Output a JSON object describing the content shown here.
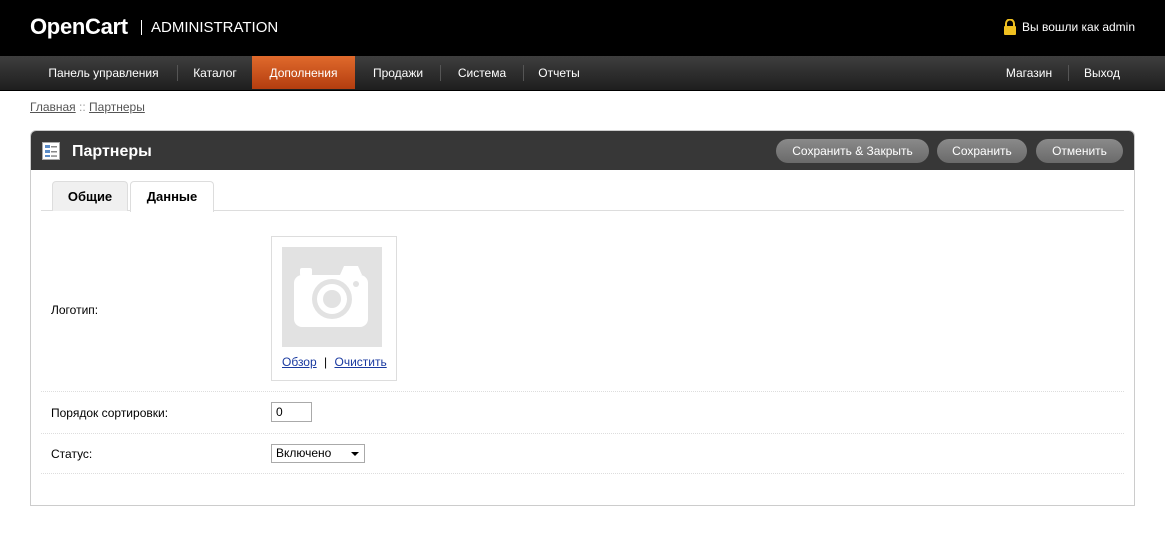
{
  "header": {
    "logo": "OpenCart",
    "admin_label": "ADMINISTRATION",
    "login_text": "Вы вошли как admin"
  },
  "menu": {
    "left": [
      "Панель управления",
      "Каталог",
      "Дополнения",
      "Продажи",
      "Система",
      "Отчеты"
    ],
    "active": "Дополнения",
    "right": [
      "Магазин",
      "Выход"
    ]
  },
  "breadcrumb": {
    "home": "Главная",
    "separator": " :: ",
    "current": "Партнеры"
  },
  "box": {
    "title": "Партнеры",
    "buttons": {
      "save_close": "Сохранить & Закрыть",
      "save": "Сохранить",
      "cancel": "Отменить"
    }
  },
  "tabs": [
    "Общие",
    "Данные"
  ],
  "active_tab": "Данные",
  "form": {
    "logo_label": "Логотип:",
    "browse_link": "Обзор",
    "link_separator": "|",
    "clear_link": "Очистить",
    "sort_label": "Порядок сортировки:",
    "sort_value": "0",
    "status_label": "Статус:",
    "status_value": "Включено"
  },
  "colors": {
    "active_menu": "#c8501a",
    "header_bg": "#000000",
    "box_head": "#373737"
  }
}
